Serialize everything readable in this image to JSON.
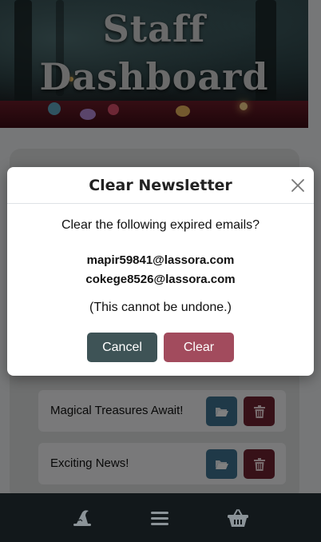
{
  "hero": {
    "title_line1": "Staff",
    "title_line2": "Dashboard"
  },
  "newsletters": [
    {
      "title": "Magical Treasures Await!"
    },
    {
      "title": "Exciting News!"
    }
  ],
  "modal": {
    "title": "Clear Newsletter",
    "prompt": "Clear the following expired emails?",
    "emails": [
      "mapir59841@lassora.com",
      "cokege8526@lassora.com"
    ],
    "warning": "(This cannot be undone.)",
    "cancel_label": "Cancel",
    "clear_label": "Clear"
  },
  "colors": {
    "cancel": "#3e5356",
    "clear": "#a24b5d",
    "open": "#3f7390",
    "delete": "#6e2331",
    "nav_bg": "#12181b"
  },
  "nav": {
    "items": [
      {
        "icon": "wizard-hat-icon"
      },
      {
        "icon": "menu-icon"
      },
      {
        "icon": "basket-icon"
      }
    ]
  }
}
